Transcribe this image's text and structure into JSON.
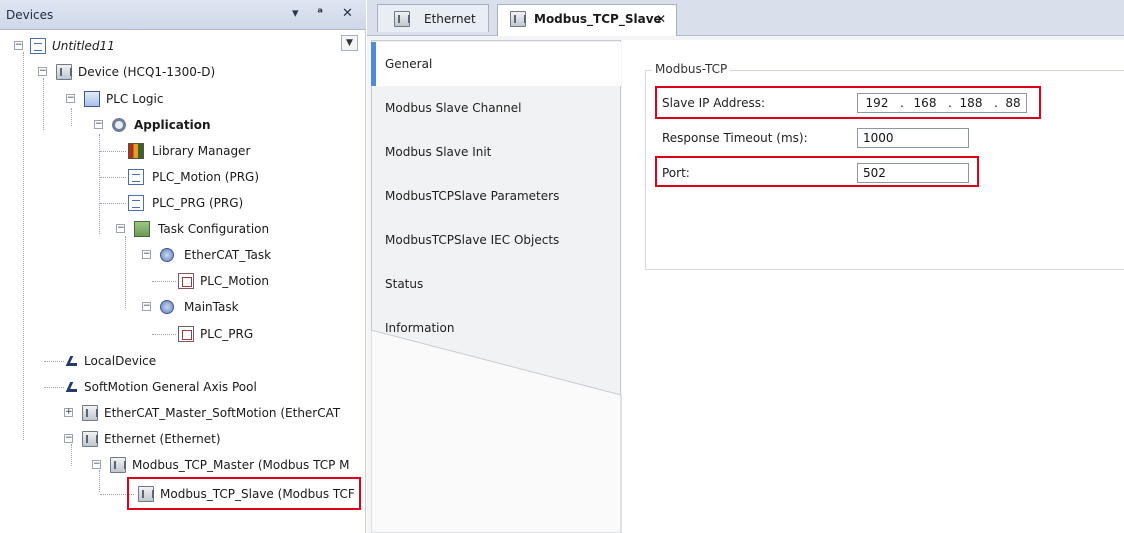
{
  "devices_panel": {
    "title": "Devices",
    "controls": {
      "dropdown": "▾",
      "pin": "ᵃ",
      "close": "✕"
    },
    "scroll_arrow": "▼",
    "tree": [
      {
        "label": "Untitled11",
        "italic": true
      },
      {
        "label": "Device (HCQ1-1300-D)"
      },
      {
        "label": "PLC Logic"
      },
      {
        "label": "Application",
        "bold": true
      },
      {
        "label": "Library Manager"
      },
      {
        "label": "PLC_Motion (PRG)"
      },
      {
        "label": "PLC_PRG (PRG)"
      },
      {
        "label": "Task Configuration"
      },
      {
        "label": "EtherCAT_Task"
      },
      {
        "label": "PLC_Motion"
      },
      {
        "label": "MainTask"
      },
      {
        "label": "PLC_PRG"
      },
      {
        "label": "LocalDevice"
      },
      {
        "label": "SoftMotion General Axis Pool"
      },
      {
        "label": "EtherCAT_Master_SoftMotion (EtherCAT"
      },
      {
        "label": "Ethernet (Ethernet)"
      },
      {
        "label": "Modbus_TCP_Master (Modbus TCP M"
      },
      {
        "label": "Modbus_TCP_Slave (Modbus TCF"
      }
    ]
  },
  "editor": {
    "tabs": [
      {
        "label": "Ethernet",
        "active": false
      },
      {
        "label": "Modbus_TCP_Slave",
        "active": true,
        "close": "✕"
      }
    ],
    "subtabs": [
      {
        "label": "General",
        "active": true
      },
      {
        "label": "Modbus Slave Channel"
      },
      {
        "label": "Modbus Slave Init"
      },
      {
        "label": "ModbusTCPSlave Parameters"
      },
      {
        "label": "ModbusTCPSlave IEC Objects"
      },
      {
        "label": "Status"
      },
      {
        "label": "Information"
      }
    ],
    "group_title": "Modbus-TCP",
    "fields": {
      "slave_ip_label": "Slave IP Address:",
      "slave_ip": [
        "192",
        "168",
        "188",
        "88"
      ],
      "ip_separator": ".",
      "timeout_label": "Response Timeout (ms):",
      "timeout_value": "1000",
      "port_label": "Port:",
      "port_value": "502"
    }
  },
  "highlight_color": "#e0001a",
  "accent_color": "#4f8bd6"
}
